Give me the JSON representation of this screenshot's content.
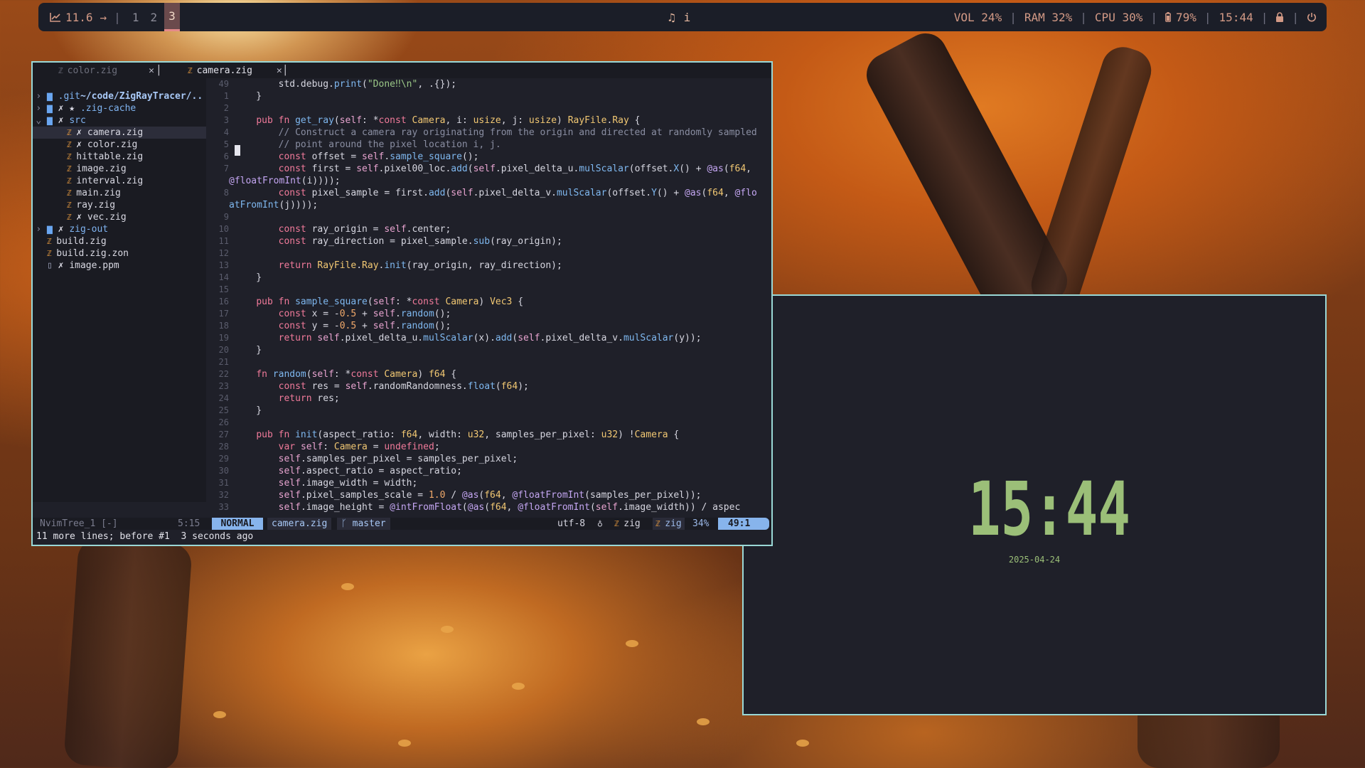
{
  "topbar": {
    "graph_value": "11.6",
    "arrow": "→",
    "separator": "|",
    "workspaces": [
      "1",
      "2",
      "3"
    ],
    "active_workspace": "3",
    "center_info": "i",
    "vol": "VOL 24%",
    "ram": "RAM 32%",
    "cpu": "CPU 30%",
    "battery": "79%",
    "time": "15:44"
  },
  "clock": {
    "time": "15:44",
    "date": "2025-04-24",
    "color": "#9bbf78"
  },
  "editor": {
    "tabs": [
      {
        "label": "color.zig",
        "close": "✕"
      },
      {
        "label": "camera.zig",
        "close": "✕"
      }
    ],
    "tree": {
      "root": "~/code/ZigRayTracer/..",
      "items": [
        {
          "arrow": "›",
          "marks": "",
          "name": ".git",
          "kind": "folder"
        },
        {
          "arrow": "›",
          "marks": "✗ ★ ",
          "name": ".zig-cache",
          "kind": "folder"
        },
        {
          "arrow": "⌄",
          "marks": "✗ ",
          "name": "src",
          "kind": "folder-open"
        },
        {
          "marks": "✗ ",
          "name": "camera.zig",
          "kind": "zig",
          "selected": true
        },
        {
          "marks": "✗ ",
          "name": "color.zig",
          "kind": "zig"
        },
        {
          "marks": "",
          "name": "hittable.zig",
          "kind": "zig"
        },
        {
          "marks": "",
          "name": "image.zig",
          "kind": "zig"
        },
        {
          "marks": "",
          "name": "interval.zig",
          "kind": "zig"
        },
        {
          "marks": "",
          "name": "main.zig",
          "kind": "zig"
        },
        {
          "marks": "",
          "name": "ray.zig",
          "kind": "zig"
        },
        {
          "marks": "✗ ",
          "name": "vec.zig",
          "kind": "zig"
        },
        {
          "arrow": "›",
          "marks": "✗ ",
          "name": "zig-out",
          "kind": "folder"
        },
        {
          "marks": "",
          "name": "build.zig",
          "kind": "zig"
        },
        {
          "marks": "",
          "name": "build.zig.zon",
          "kind": "zig"
        },
        {
          "marks": "✗ ",
          "name": "image.ppm",
          "kind": "doc"
        }
      ]
    },
    "code_lines": [
      {
        "n": "49",
        "text": "        std.debug.print(\"Done‼\\n\", .{});"
      },
      {
        "n": "1",
        "text": "    }"
      },
      {
        "n": "2",
        "text": ""
      },
      {
        "n": "3",
        "text": "    pub fn get_ray(self: *const Camera, i: usize, j: usize) RayFile.Ray {"
      },
      {
        "n": "4",
        "text": "        // Construct a camera ray originating from the origin and directed at randomly sampled"
      },
      {
        "n": "5",
        "text": "        // point around the pixel location i, j."
      },
      {
        "n": "6",
        "text": "        const offset = self.sample_square();"
      },
      {
        "n": "7",
        "text": "        const first = self.pixel00_loc.add(self.pixel_delta_u.mulScalar(offset.X() + @as(f64,"
      },
      {
        "n": "",
        "text": "@floatFromInt(i))));"
      },
      {
        "n": "8",
        "text": "        const pixel_sample = first.add(self.pixel_delta_v.mulScalar(offset.Y() + @as(f64, @flo"
      },
      {
        "n": "",
        "text": "atFromInt(j))));"
      },
      {
        "n": "9",
        "text": ""
      },
      {
        "n": "10",
        "text": "        const ray_origin = self.center;"
      },
      {
        "n": "11",
        "text": "        const ray_direction = pixel_sample.sub(ray_origin);"
      },
      {
        "n": "12",
        "text": ""
      },
      {
        "n": "13",
        "text": "        return RayFile.Ray.init(ray_origin, ray_direction);"
      },
      {
        "n": "14",
        "text": "    }"
      },
      {
        "n": "15",
        "text": ""
      },
      {
        "n": "16",
        "text": "    pub fn sample_square(self: *const Camera) Vec3 {"
      },
      {
        "n": "17",
        "text": "        const x = -0.5 + self.random();"
      },
      {
        "n": "18",
        "text": "        const y = -0.5 + self.random();"
      },
      {
        "n": "19",
        "text": "        return self.pixel_delta_u.mulScalar(x).add(self.pixel_delta_v.mulScalar(y));"
      },
      {
        "n": "20",
        "text": "    }"
      },
      {
        "n": "21",
        "text": ""
      },
      {
        "n": "22",
        "text": "    fn random(self: *const Camera) f64 {"
      },
      {
        "n": "23",
        "text": "        const res = self.randomRandomness.float(f64);"
      },
      {
        "n": "24",
        "text": "        return res;"
      },
      {
        "n": "25",
        "text": "    }"
      },
      {
        "n": "26",
        "text": ""
      },
      {
        "n": "27",
        "text": "    pub fn init(aspect_ratio: f64, width: u32, samples_per_pixel: u32) !Camera {"
      },
      {
        "n": "28",
        "text": "        var self: Camera = undefined;"
      },
      {
        "n": "29",
        "text": "        self.samples_per_pixel = samples_per_pixel;"
      },
      {
        "n": "30",
        "text": "        self.aspect_ratio = aspect_ratio;"
      },
      {
        "n": "31",
        "text": "        self.image_width = width;"
      },
      {
        "n": "32",
        "text": "        self.pixel_samples_scale = 1.0 / @as(f64, @floatFromInt(samples_per_pixel));"
      },
      {
        "n": "33",
        "text": "        self.image_height = @intFromFloat(@as(f64, @floatFromInt(self.image_width)) / aspec@@@"
      }
    ],
    "status": {
      "tree_name": "NvimTree_1 [-]",
      "tree_pos": "5:15",
      "mode": "NORMAL",
      "file": "camera.zig",
      "branch": "master",
      "encoding": "utf-8",
      "filetype": "zig",
      "filetype2": "zig",
      "percent": "34%",
      "cursor": "49:1"
    },
    "message": "11 more lines; before #1  3 seconds ago"
  }
}
